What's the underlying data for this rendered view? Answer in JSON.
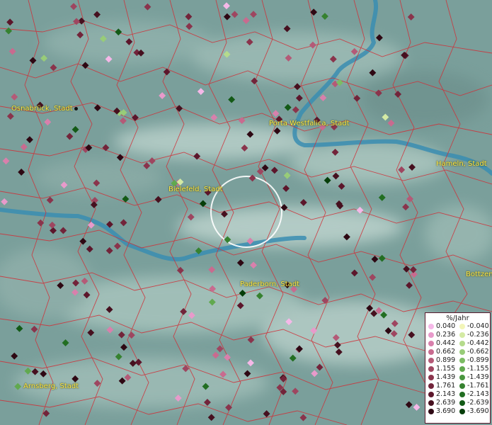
{
  "map": {
    "cities": [
      {
        "label": "Osnabrück, Stadt"
      },
      {
        "label": "Porta Westfalica, Stadt"
      },
      {
        "label": "Hameln, Stadt"
      },
      {
        "label": "Bielefeld, Stadt"
      },
      {
        "label": "Paderborn, Stadt"
      },
      {
        "label": "Bottzen"
      },
      {
        "label": "Arnsberg, Stadt"
      }
    ]
  },
  "legend": {
    "title": "%/Jahr",
    "positive": [
      "0.040",
      "0.236",
      "0.442",
      "0.662",
      "0.899",
      "1.155",
      "1.439",
      "1.761",
      "2.143",
      "2.639",
      "3.690"
    ],
    "negative": [
      "-0.040",
      "-0.236",
      "-0.442",
      "-0.662",
      "-0.899",
      "-1.155",
      "-1.439",
      "-1.761",
      "-2.143",
      "-2.639",
      "-3.690"
    ],
    "positive_colors": [
      "#f5b8e8",
      "#e89acb",
      "#d880ac",
      "#c86b8f",
      "#b45a77",
      "#9e4660",
      "#8a344c",
      "#72243a",
      "#5c162b",
      "#46101f",
      "#2e0813"
    ],
    "negative_colors": [
      "#f2f5b8",
      "#d4eaa4",
      "#b5db8c",
      "#98cc78",
      "#7cbc64",
      "#61a94f",
      "#4a963f",
      "#368230",
      "#226e22",
      "#135a16",
      "#063e0a"
    ]
  },
  "colors": {
    "river": "#3c8fb0",
    "borders": "#c8343c",
    "selection_circle": "#ffffff"
  }
}
